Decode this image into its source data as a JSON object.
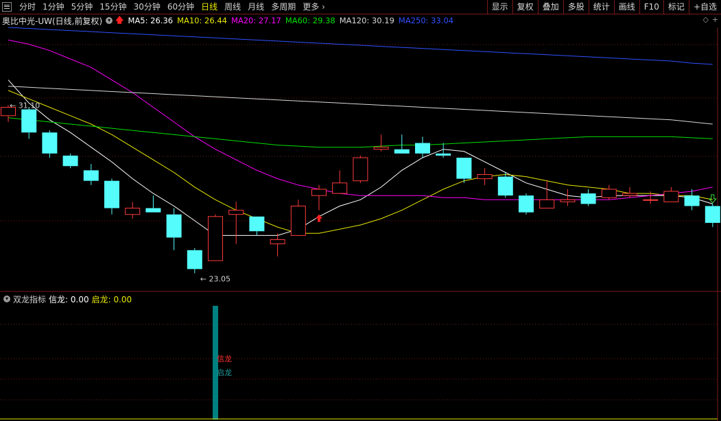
{
  "toolbar": {
    "periods": [
      "分时",
      "1分钟",
      "5分钟",
      "15分钟",
      "30分钟",
      "60分钟",
      "日线",
      "周线",
      "月线",
      "多周期",
      "更多"
    ],
    "active_period": "日线",
    "buttons": [
      "显示",
      "复权",
      "叠加",
      "多股",
      "统计",
      "画线",
      "F10",
      "标记",
      "+自选"
    ]
  },
  "header": {
    "title": "奥比中光-UW(日线,前复权)",
    "ma": [
      {
        "label": "MA5: 26.36",
        "color": "#ffffff"
      },
      {
        "label": "MA10: 26.44",
        "color": "#e8e800"
      },
      {
        "label": "MA20: 27.17",
        "color": "#ff00ff"
      },
      {
        "label": "MA60: 29.38",
        "color": "#00e000"
      },
      {
        "label": "MA120: 30.19",
        "color": "#d8d8d8"
      },
      {
        "label": "MA250: 33.04",
        "color": "#3050ff"
      }
    ]
  },
  "indicator": {
    "name": "双龙指标",
    "xinlong_label": "信龙: 0.00",
    "qilong_label": "启龙: 0.00",
    "xinlong_text": "信龙",
    "qilong_text": "启龙"
  },
  "colors": {
    "up": "#ff3b3b",
    "down": "#54fcfc",
    "grid": "#7a1a1a",
    "signal_bar": "#008080"
  },
  "chart_data": {
    "type": "candlestick",
    "y_range": [
      22.4,
      34.8
    ],
    "annotations": {
      "high_label": "31.10",
      "low_label": "23.05"
    },
    "candles": [
      {
        "o": 30.6,
        "h": 31.1,
        "l": 30.3,
        "c": 31.0
      },
      {
        "o": 30.9,
        "h": 31.0,
        "l": 29.5,
        "c": 29.8
      },
      {
        "o": 29.8,
        "h": 29.9,
        "l": 28.6,
        "c": 28.8
      },
      {
        "o": 28.7,
        "h": 28.8,
        "l": 28.1,
        "c": 28.2
      },
      {
        "o": 28.0,
        "h": 28.3,
        "l": 27.3,
        "c": 27.5
      },
      {
        "o": 27.5,
        "h": 27.6,
        "l": 25.9,
        "c": 26.2
      },
      {
        "o": 25.9,
        "h": 26.5,
        "l": 25.7,
        "c": 26.2
      },
      {
        "o": 26.2,
        "h": 26.8,
        "l": 26.0,
        "c": 26.0
      },
      {
        "o": 25.9,
        "h": 26.2,
        "l": 24.2,
        "c": 24.8
      },
      {
        "o": 24.2,
        "h": 24.3,
        "l": 23.1,
        "c": 23.3
      },
      {
        "o": 23.7,
        "h": 25.9,
        "l": 23.7,
        "c": 25.8
      },
      {
        "o": 25.9,
        "h": 26.5,
        "l": 24.5,
        "c": 26.1
      },
      {
        "o": 25.8,
        "h": 25.8,
        "l": 24.9,
        "c": 25.1
      },
      {
        "o": 24.5,
        "h": 25.0,
        "l": 23.9,
        "c": 24.7
      },
      {
        "o": 24.9,
        "h": 26.6,
        "l": 24.9,
        "c": 26.3
      },
      {
        "o": 26.8,
        "h": 27.3,
        "l": 26.1,
        "c": 27.1
      },
      {
        "o": 26.9,
        "h": 28.0,
        "l": 26.9,
        "c": 27.4
      },
      {
        "o": 27.5,
        "h": 28.7,
        "l": 27.4,
        "c": 28.6
      },
      {
        "o": 29.0,
        "h": 29.7,
        "l": 28.9,
        "c": 29.1
      },
      {
        "o": 29.0,
        "h": 29.7,
        "l": 28.8,
        "c": 28.8
      },
      {
        "o": 29.3,
        "h": 29.6,
        "l": 28.6,
        "c": 28.8
      },
      {
        "o": 28.8,
        "h": 29.3,
        "l": 28.6,
        "c": 28.7
      },
      {
        "o": 28.6,
        "h": 28.6,
        "l": 27.4,
        "c": 27.6
      },
      {
        "o": 27.6,
        "h": 28.1,
        "l": 27.3,
        "c": 27.8
      },
      {
        "o": 27.7,
        "h": 27.9,
        "l": 26.7,
        "c": 26.8
      },
      {
        "o": 26.8,
        "h": 26.9,
        "l": 25.9,
        "c": 26.0
      },
      {
        "o": 26.2,
        "h": 27.5,
        "l": 26.2,
        "c": 26.6
      },
      {
        "o": 26.5,
        "h": 27.1,
        "l": 26.3,
        "c": 26.6
      },
      {
        "o": 26.9,
        "h": 27.1,
        "l": 26.3,
        "c": 26.4
      },
      {
        "o": 26.7,
        "h": 27.3,
        "l": 26.6,
        "c": 27.1
      },
      {
        "o": 26.8,
        "h": 27.2,
        "l": 26.7,
        "c": 26.9
      },
      {
        "o": 26.6,
        "h": 27.0,
        "l": 26.4,
        "c": 26.6
      },
      {
        "o": 26.5,
        "h": 27.2,
        "l": 26.5,
        "c": 27.0
      },
      {
        "o": 26.8,
        "h": 27.1,
        "l": 26.1,
        "c": 26.3
      },
      {
        "o": 26.3,
        "h": 26.4,
        "l": 25.3,
        "c": 25.5
      }
    ],
    "series": [
      {
        "name": "MA5",
        "color": "#ffffff",
        "values": [
          32.3,
          31.2,
          30.4,
          29.8,
          29.1,
          28.4,
          27.6,
          26.9,
          26.3,
          25.6,
          24.9,
          24.9,
          24.9,
          24.9,
          25.2,
          25.8,
          26.3,
          26.6,
          27.2,
          28.0,
          28.6,
          29.0,
          28.9,
          28.4,
          27.9,
          27.4,
          27.1,
          26.8,
          26.7,
          26.8,
          26.8,
          26.8,
          26.8,
          26.7,
          26.4
        ]
      },
      {
        "name": "MA10",
        "color": "#e8e800",
        "values": [
          31.8,
          31.4,
          31.0,
          30.6,
          30.2,
          29.7,
          29.1,
          28.5,
          27.9,
          27.2,
          26.6,
          26.1,
          25.7,
          25.3,
          25.0,
          25.0,
          25.2,
          25.4,
          25.7,
          26.1,
          26.6,
          27.1,
          27.5,
          27.7,
          27.8,
          27.7,
          27.5,
          27.3,
          27.2,
          27.1,
          26.9,
          26.9,
          26.8,
          26.8,
          26.6
        ]
      },
      {
        "name": "MA20",
        "color": "#ff00ff",
        "values": [
          34.2,
          34.0,
          33.7,
          33.3,
          32.9,
          32.3,
          31.7,
          31.0,
          30.3,
          29.6,
          29.0,
          28.5,
          28.0,
          27.6,
          27.3,
          27.1,
          26.9,
          26.8,
          26.8,
          26.8,
          26.8,
          26.7,
          26.7,
          26.6,
          26.6,
          26.6,
          26.6,
          26.6,
          26.6,
          26.6,
          26.7,
          26.8,
          26.9,
          27.0,
          27.2
        ]
      },
      {
        "name": "MA60",
        "color": "#00e000",
        "values": [
          30.5,
          30.4,
          30.3,
          30.2,
          30.1,
          30.0,
          29.9,
          29.8,
          29.7,
          29.6,
          29.5,
          29.4,
          29.3,
          29.2,
          29.15,
          29.1,
          29.1,
          29.1,
          29.15,
          29.2,
          29.2,
          29.25,
          29.3,
          29.35,
          29.4,
          29.45,
          29.5,
          29.55,
          29.6,
          29.6,
          29.6,
          29.6,
          29.6,
          29.55,
          29.5
        ]
      },
      {
        "name": "MA120",
        "color": "#d8d8d8",
        "values": [
          32.0,
          31.95,
          31.9,
          31.85,
          31.8,
          31.75,
          31.7,
          31.65,
          31.6,
          31.55,
          31.5,
          31.45,
          31.4,
          31.35,
          31.3,
          31.25,
          31.2,
          31.15,
          31.1,
          31.05,
          31.0,
          30.95,
          30.9,
          30.85,
          30.8,
          30.75,
          30.7,
          30.65,
          30.6,
          30.55,
          30.5,
          30.45,
          30.4,
          30.3,
          30.2
        ]
      },
      {
        "name": "MA250",
        "color": "#3050ff",
        "values": [
          34.8,
          34.75,
          34.7,
          34.65,
          34.6,
          34.55,
          34.5,
          34.45,
          34.4,
          34.35,
          34.3,
          34.25,
          34.2,
          34.15,
          34.1,
          34.05,
          34.0,
          33.95,
          33.9,
          33.85,
          33.8,
          33.75,
          33.7,
          33.65,
          33.6,
          33.55,
          33.5,
          33.45,
          33.4,
          33.35,
          33.3,
          33.25,
          33.2,
          33.1,
          33.04
        ]
      }
    ],
    "signals": {
      "up_arrow_index": 15,
      "down_arrow_index": 34
    },
    "sub_indicator": {
      "xinlong": [
        0,
        0,
        0,
        0,
        0,
        0,
        0,
        0,
        0,
        0,
        1,
        0,
        0,
        0,
        0,
        0,
        0,
        0,
        0,
        0,
        0,
        0,
        0,
        0,
        0,
        0,
        0,
        0,
        0,
        0,
        0,
        0,
        0,
        0,
        0
      ]
    }
  }
}
